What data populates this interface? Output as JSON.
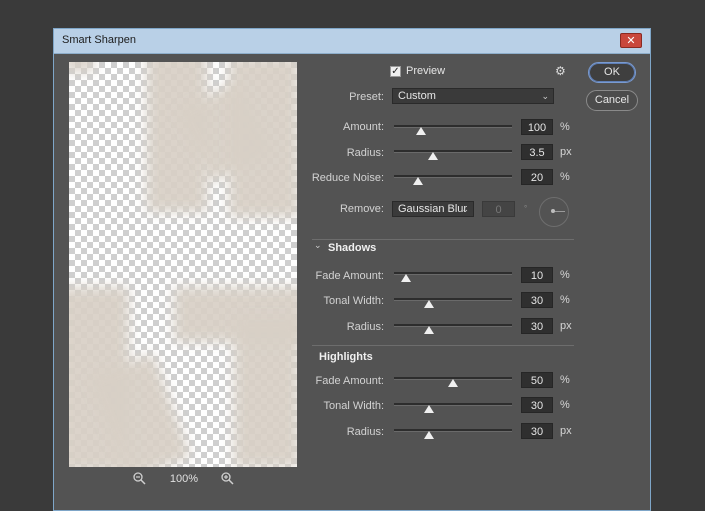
{
  "window": {
    "title": "Smart Sharpen",
    "close_label": "✕"
  },
  "preview_panel": {
    "zoom_level": "100%"
  },
  "options": {
    "preview_label": "Preview",
    "preview_checked": true
  },
  "buttons": {
    "ok": "OK",
    "cancel": "Cancel"
  },
  "preset": {
    "label": "Preset:",
    "value": "Custom"
  },
  "sharpen": {
    "amount": {
      "label": "Amount:",
      "value": "100",
      "unit": "%",
      "level": 0.23
    },
    "radius": {
      "label": "Radius:",
      "value": "3.5",
      "unit": "px",
      "level": 0.33
    },
    "reduce_noise": {
      "label": "Reduce Noise:",
      "value": "20",
      "unit": "%",
      "level": 0.2
    }
  },
  "remove": {
    "label": "Remove:",
    "value": "Gaussian Blur",
    "angle": "0",
    "degree": "°"
  },
  "shadows": {
    "header": "Shadows",
    "fade_amount": {
      "label": "Fade Amount:",
      "value": "10",
      "unit": "%",
      "level": 0.1
    },
    "tonal_width": {
      "label": "Tonal Width:",
      "value": "30",
      "unit": "%",
      "level": 0.3
    },
    "radius": {
      "label": "Radius:",
      "value": "30",
      "unit": "px",
      "level": 0.3
    }
  },
  "highlights": {
    "header": "Highlights",
    "fade_amount": {
      "label": "Fade Amount:",
      "value": "50",
      "unit": "%",
      "level": 0.5
    },
    "tonal_width": {
      "label": "Tonal Width:",
      "value": "30",
      "unit": "%",
      "level": 0.3
    },
    "radius": {
      "label": "Radius:",
      "value": "30",
      "unit": "px",
      "level": 0.3
    }
  },
  "colors": {
    "accent": "#7a9bd0",
    "panel": "#535353",
    "titlebar": "#b9d0e7",
    "close": "#c9473c"
  }
}
